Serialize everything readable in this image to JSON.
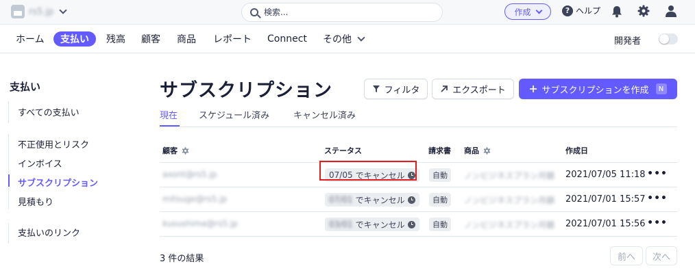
{
  "topbar": {
    "account_name": "rs5.jp",
    "search_placeholder": "検索...",
    "create_label": "作成",
    "help_label": "ヘルプ"
  },
  "nav": {
    "items": [
      "ホーム",
      "支払い",
      "残高",
      "顧客",
      "商品",
      "レポート",
      "Connect",
      "その他"
    ],
    "active": "支払い",
    "developer_label": "開発者"
  },
  "sidebar": {
    "title": "支払い",
    "items": [
      "すべての支払い",
      "不正使用とリスク",
      "インボイス",
      "サブスクリプション",
      "見積もり",
      "支払いのリンク"
    ],
    "active": "サブスクリプション"
  },
  "page": {
    "title": "サブスクリプション",
    "filter_label": "フィルタ",
    "export_label": "エクスポート",
    "create_label": "サブスクリプションを作成",
    "create_shortcut": "N",
    "tabs": [
      "現在",
      "スケジュール済み",
      "キャンセル済み"
    ],
    "active_tab": "現在"
  },
  "table": {
    "headers": {
      "customer": "顧客",
      "status": "ステータス",
      "invoice": "請求書",
      "product": "商品",
      "created": "作成日"
    },
    "rows": [
      {
        "customer": "axont@rs5.jp",
        "status_date": "07/05",
        "status_suffix": "でキャンセル",
        "invoice": "自動",
        "product": "ノンビジネスプラン月額",
        "created": "2021/07/05 11:18"
      },
      {
        "customer": "mitsuge@rs5.jp",
        "status_date": "07/01",
        "status_suffix": "でキャンセル",
        "invoice": "自動",
        "product": "ノンビジネスプラン月額",
        "created": "2021/07/01 15:57"
      },
      {
        "customer": "kusushima@rs5.jp",
        "status_date": "03/01",
        "status_suffix": "でキャンセル",
        "invoice": "自動",
        "product": "ノンビジネスプラン月額",
        "created": "2021/07/01 15:56"
      }
    ],
    "more_label": "•••"
  },
  "footer": {
    "results": "3 件の結果",
    "prev_label": "前へ",
    "next_label": "次へ"
  },
  "colors": {
    "accent": "#635bff",
    "highlight": "#e01c1c"
  }
}
